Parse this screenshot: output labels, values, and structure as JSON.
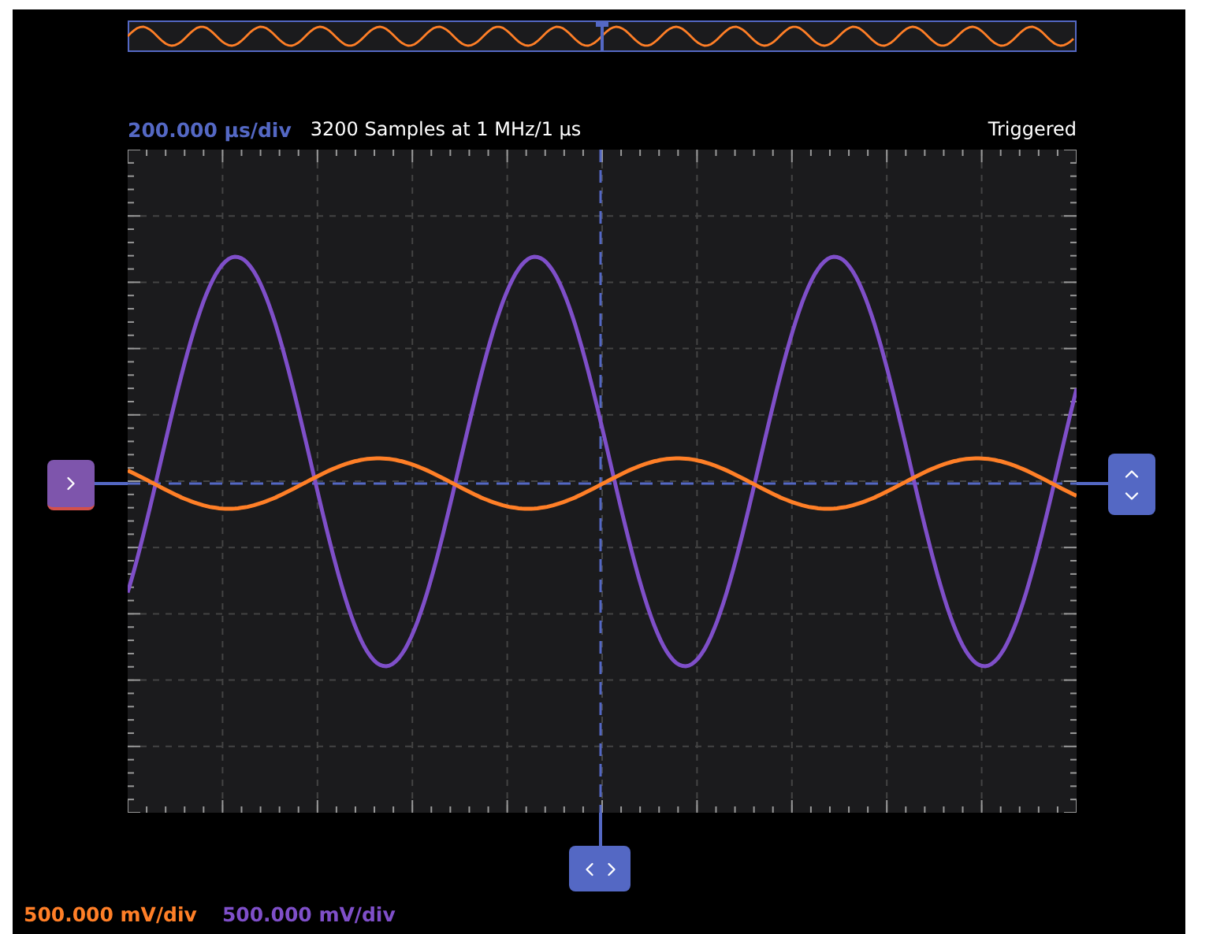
{
  "header": {
    "timebase": "200.000 µs/div",
    "samples": "3200 Samples at 1 MHz/1 µs",
    "status": "Triggered"
  },
  "channels": [
    {
      "scale": "500.000 mV/div",
      "color": "#ff7f27"
    },
    {
      "scale": "500.000 mV/div",
      "color": "#7f4fc9"
    }
  ]
}
